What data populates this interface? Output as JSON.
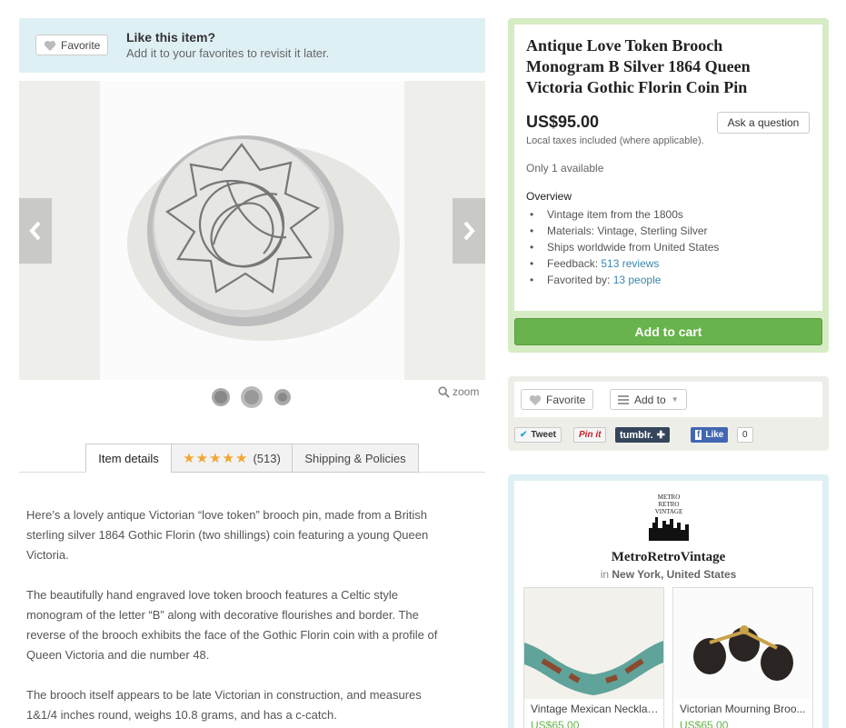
{
  "favorite_banner": {
    "button_label": "Favorite",
    "title": "Like this item?",
    "subtitle": "Add it to your favorites to revisit it later."
  },
  "gallery": {
    "zoom_label": "zoom",
    "thumbnail_count": 3
  },
  "tabs": {
    "details": "Item details",
    "reviews_stars": "★★★★★",
    "reviews_count": "(513)",
    "shipping": "Shipping & Policies"
  },
  "description": [
    "Here’s a lovely antique Victorian “love token” brooch pin, made from a British sterling silver 1864 Gothic Florin (two shillings) coin featuring a young Queen Victoria.",
    "The beautifully hand engraved love token brooch features a Celtic style monogram of the letter “B” along with decorative flourishes and border. The reverse of the brooch exhibits the face of the Gothic Florin coin with a profile of Queen Victoria and die number 48.",
    "The brooch itself appears to be late Victorian in construction, and measures 1&1/4 inches round, weighs 10.8 grams, and has a c-catch."
  ],
  "listing": {
    "title": "Antique Love Token Brooch Monogram B Silver 1864 Queen Victoria Gothic Florin Coin Pin",
    "price": "US$95.00",
    "ask_button": "Ask a question",
    "taxes_note": "Local taxes included (where applicable).",
    "availability": "Only 1 available",
    "overview_title": "Overview",
    "overview": {
      "item_age": "Vintage item from the 1800s",
      "materials": "Materials: Vintage, Sterling Silver",
      "ships": "Ships worldwide from United States",
      "feedback_label": "Feedback: ",
      "feedback_link": "513 reviews",
      "favorited_label": "Favorited by: ",
      "favorited_link": "13 people"
    },
    "add_to_cart": "Add to cart"
  },
  "actions": {
    "favorite": "Favorite",
    "add_to": "Add to",
    "tweet": "Tweet",
    "pin": "Pin it",
    "tumblr": "tumblr.",
    "fb_like": "Like",
    "fb_count": "0"
  },
  "shop": {
    "logo_text": [
      "METRO",
      "RETRO",
      "VINTAGE"
    ],
    "name": "MetroRetroVintage",
    "location_prefix": "in",
    "location": "New York, United States",
    "items": [
      {
        "title": "Vintage Mexican Necklac...",
        "price": "US$65.00"
      },
      {
        "title": "Victorian Mourning Broo...",
        "price": "US$65.00"
      }
    ]
  },
  "colors": {
    "accent_green": "#68b34b",
    "link_blue": "#3a89ad",
    "banner_blue": "#dff0f5",
    "listing_green_border": "#d6ecc4",
    "star_orange": "#f3a531"
  }
}
